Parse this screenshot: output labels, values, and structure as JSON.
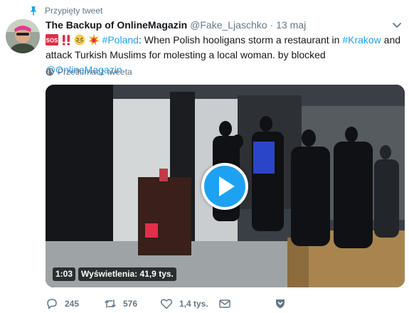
{
  "pinned": {
    "label": "Przypięty tweet"
  },
  "tweet": {
    "display_name": "The Backup of OnlineMagazin",
    "handle": "@Fake_Ljaschko",
    "separator": "·",
    "timestamp": "13 maj",
    "text": {
      "hashtag_poland": "#Poland",
      "part1": ": When Polish hooligans storm a restaurant in ",
      "hashtag_krakow": "#Krakow",
      "part2": " and attack Turkish Muslims for molesting a local woman. by blocked ",
      "mention": "@OnlineMagazin"
    },
    "emojis": [
      "sos-emoji",
      "double-exclamation-emoji",
      "grinning-face-emoji",
      "collision-emoji"
    ],
    "translate_label": "Przetłumacz tweeta"
  },
  "video": {
    "duration": "1:03",
    "views": "Wyświetlenia: 41,9 tys."
  },
  "actions": {
    "replies": "245",
    "retweets": "576",
    "likes": "1,4 tys."
  },
  "colors": {
    "accent": "#1da1f2",
    "secondary_text": "#657786",
    "primary_text": "#14171a"
  }
}
